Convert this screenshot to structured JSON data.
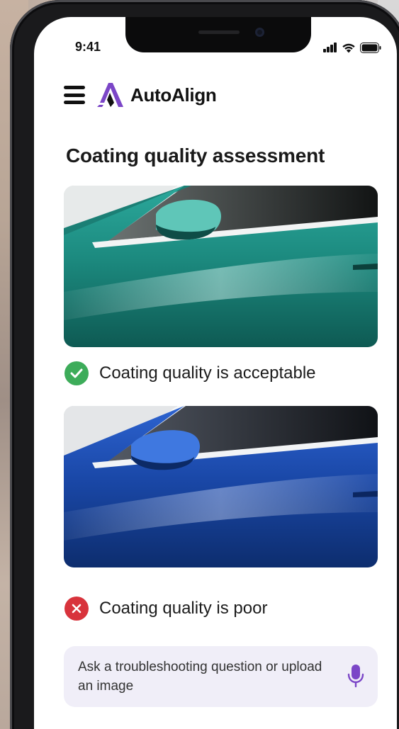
{
  "status_bar": {
    "time": "9:41"
  },
  "header": {
    "brand_name": "AutoAlign"
  },
  "page": {
    "title": "Coating quality assessment"
  },
  "results": [
    {
      "status": "acceptable",
      "label": "Coating quality is acceptable",
      "icon": "check-circle-icon",
      "color": "#3dac5a"
    },
    {
      "status": "poor",
      "label": "Coating quality is poor",
      "icon": "x-circle-icon",
      "color": "#d8333c"
    }
  ],
  "ask": {
    "placeholder": "Ask a troubleshooting question or upload an image"
  },
  "colors": {
    "brand_accent": "#7b46c7",
    "input_bg": "#f0eef8",
    "teal_car": "#1f8e84",
    "blue_car": "#1e4fb0"
  }
}
